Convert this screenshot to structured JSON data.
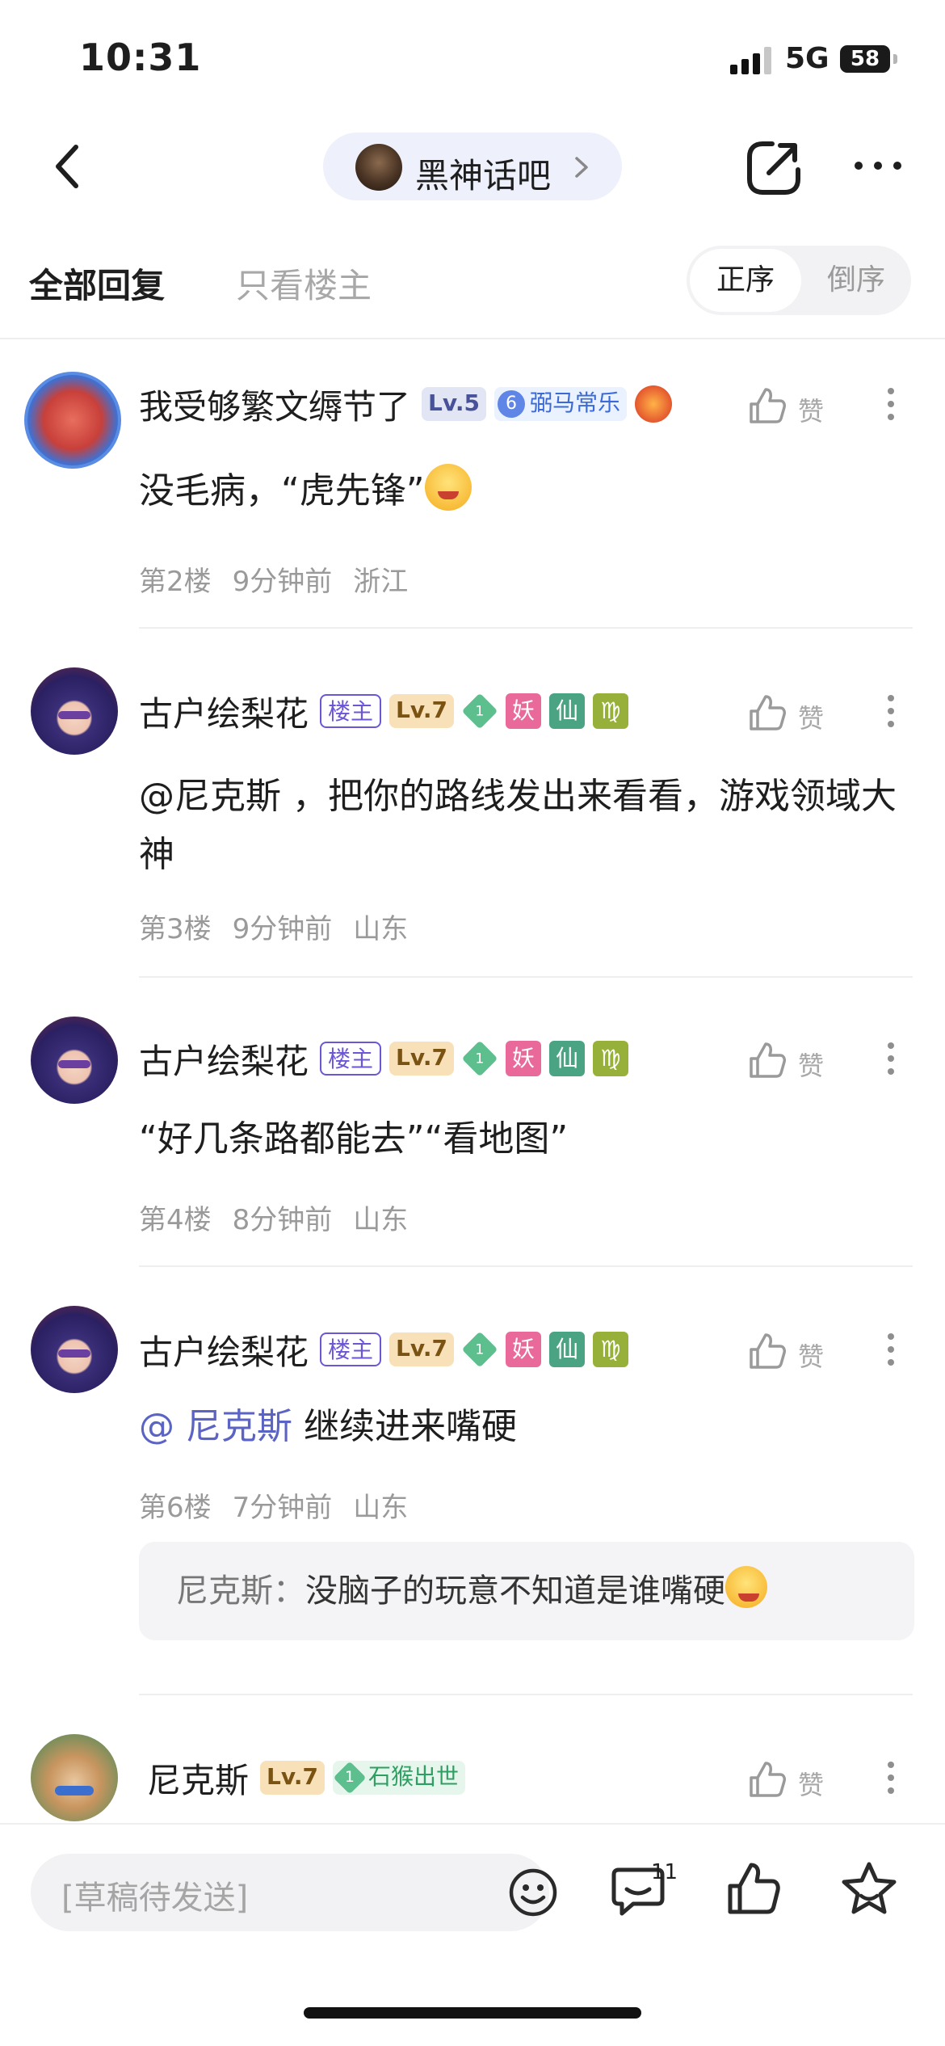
{
  "status_bar": {
    "time": "10:31",
    "network": "5G",
    "battery": "58"
  },
  "nav": {
    "forum_name": "黑神话吧"
  },
  "tabs": {
    "all_replies": "全部回复",
    "op_only": "只看楼主",
    "sort_asc": "正序",
    "sort_desc": "倒序"
  },
  "like_label": "赞",
  "replies": [
    {
      "username": "我受够繁文缛节了",
      "level": "Lv.5",
      "honor_num": "6",
      "honor_title": "弼马常乐",
      "content": "没毛病，“虎先锋”",
      "floor": "第2楼",
      "time": "9分钟前",
      "location": "浙江"
    },
    {
      "username": "古户绘梨花",
      "op_badge": "楼主",
      "level": "Lv.7",
      "gem_num": "1",
      "tags": [
        "妖",
        "仙",
        "♍"
      ],
      "content": "@尼克斯 ，把你的路线发出来看看，游戏领域大神",
      "floor": "第3楼",
      "time": "9分钟前",
      "location": "山东"
    },
    {
      "username": "古户绘梨花",
      "op_badge": "楼主",
      "level": "Lv.7",
      "gem_num": "1",
      "tags": [
        "妖",
        "仙",
        "♍"
      ],
      "content": "“好几条路都能去”“看地图”",
      "floor": "第4楼",
      "time": "8分钟前",
      "location": "山东"
    },
    {
      "username": "古户绘梨花",
      "op_badge": "楼主",
      "level": "Lv.7",
      "gem_num": "1",
      "tags": [
        "妖",
        "仙",
        "♍"
      ],
      "mention": "@ 尼克斯",
      "content": "继续进来嘴硬",
      "floor": "第6楼",
      "time": "7分钟前",
      "location": "山东",
      "sub_reply": {
        "author": "尼克斯：",
        "text": "没脑子的玩意不知道是谁嘴硬"
      }
    },
    {
      "username": "尼克斯",
      "level": "Lv.7",
      "gem_num": "1",
      "honor_title": "石猴出世"
    }
  ],
  "bottom_bar": {
    "draft_placeholder": "[草稿待发送]",
    "comment_count": "11"
  }
}
